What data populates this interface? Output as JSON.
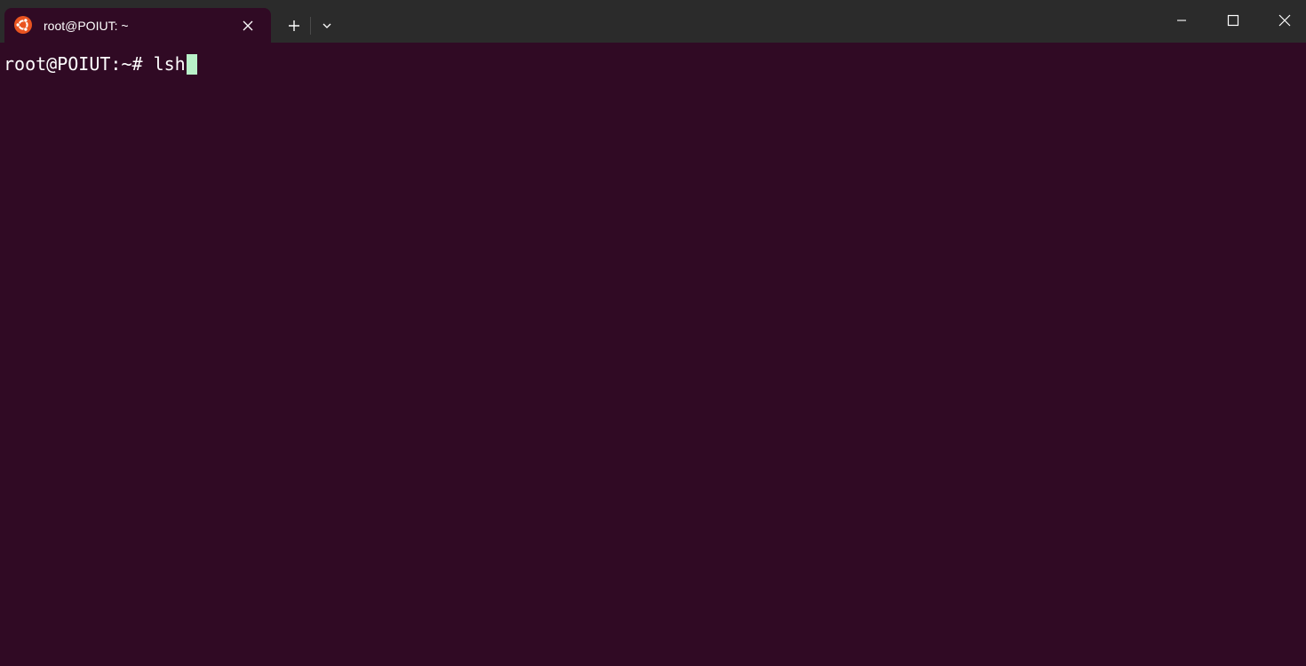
{
  "tab": {
    "title": "root@POIUT: ~",
    "icon": "ubuntu-logo-icon"
  },
  "toolbar": {
    "new_tab_icon": "plus-icon",
    "dropdown_icon": "chevron-down-icon"
  },
  "window_controls": {
    "minimize_icon": "minimize-icon",
    "maximize_icon": "maximize-icon",
    "close_icon": "close-icon"
  },
  "terminal": {
    "prompt": "root@POIUT:~# ",
    "command": "lsh"
  },
  "colors": {
    "terminal_bg": "#300a24",
    "titlebar_bg": "#2b2b2b",
    "ubuntu_orange": "#e95420",
    "cursor": "#b9f2c9",
    "text": "#ffffff"
  }
}
